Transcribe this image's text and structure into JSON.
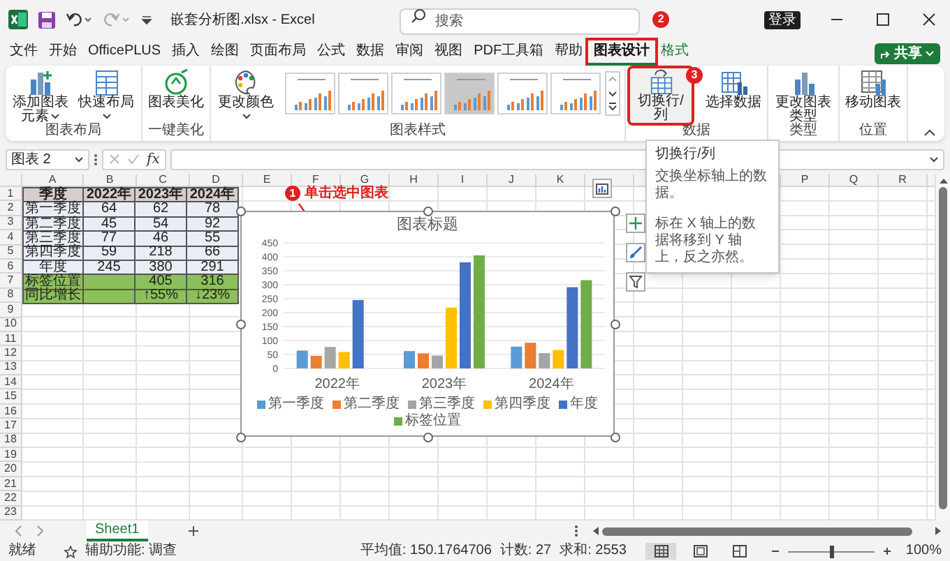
{
  "title_bar": {
    "title": "嵌套分析图.xlsx - Excel",
    "search_placeholder": "搜索",
    "login_button": "登录"
  },
  "menu_tabs": [
    {
      "label": "文件",
      "selected": false,
      "kind": "normal"
    },
    {
      "label": "开始",
      "selected": false,
      "kind": "normal"
    },
    {
      "label": "OfficePLUS",
      "selected": false,
      "kind": "normal"
    },
    {
      "label": "插入",
      "selected": false,
      "kind": "normal"
    },
    {
      "label": "绘图",
      "selected": false,
      "kind": "normal"
    },
    {
      "label": "页面布局",
      "selected": false,
      "kind": "normal"
    },
    {
      "label": "公式",
      "selected": false,
      "kind": "normal"
    },
    {
      "label": "数据",
      "selected": false,
      "kind": "normal"
    },
    {
      "label": "审阅",
      "selected": false,
      "kind": "normal"
    },
    {
      "label": "视图",
      "selected": false,
      "kind": "normal"
    },
    {
      "label": "PDF工具箱",
      "selected": false,
      "kind": "normal"
    },
    {
      "label": "帮助",
      "selected": false,
      "kind": "normal"
    },
    {
      "label": "图表设计",
      "selected": true,
      "kind": "contextual",
      "callout": "2"
    },
    {
      "label": "格式",
      "selected": false,
      "kind": "contextual"
    }
  ],
  "share_button": "共享",
  "ribbon": {
    "groups": [
      {
        "label": "图表布局",
        "commands": [
          {
            "kind": "add-element",
            "label": "添加图表元素",
            "dropdown": true
          },
          {
            "kind": "quick-layout",
            "label": "快速布局",
            "dropdown": true
          }
        ]
      },
      {
        "label": "一键美化",
        "commands": [
          {
            "kind": "beautify",
            "label": "图表美化",
            "dropdown": false
          }
        ]
      },
      {
        "label": "图表样式",
        "commands": [
          {
            "kind": "colors",
            "label": "更改颜色",
            "dropdown": true
          }
        ],
        "gallery": [
          {
            "kind": "plain"
          },
          {
            "kind": "plain"
          },
          {
            "kind": "plain"
          },
          {
            "kind": "shaded"
          },
          {
            "kind": "plain"
          },
          {
            "kind": "plain"
          }
        ]
      },
      {
        "label": "数据",
        "commands": [
          {
            "kind": "switch",
            "label": "切换行/列",
            "dropdown": false,
            "callout": "3"
          },
          {
            "kind": "select-data",
            "label": "选择数据",
            "dropdown": false
          }
        ]
      },
      {
        "label": "类型",
        "commands": [
          {
            "kind": "change-type",
            "label": "更改图表类型",
            "dropdown": false
          }
        ]
      },
      {
        "label": "位置",
        "commands": [
          {
            "kind": "move",
            "label": "移动图表",
            "dropdown": false
          }
        ]
      }
    ]
  },
  "tooltip": {
    "title": "切换行/列",
    "lines": [
      "交换坐标轴上的数据。",
      "标在 X 轴上的数据将移到 Y 轴上，反之亦然。"
    ]
  },
  "formula_bar": {
    "name_box": "图表 2",
    "function_label": "fx"
  },
  "sheet": {
    "columns": [
      "A",
      "B",
      "C",
      "D",
      "E",
      "F",
      "G",
      "H",
      "I",
      "J",
      "K",
      null,
      null,
      null,
      null,
      "P",
      "Q",
      "R"
    ],
    "rows": [
      {
        "number": "1",
        "cells": [
          {
            "text": "季度",
            "kind": "header"
          },
          {
            "text": "2022年",
            "kind": "header"
          },
          {
            "text": "2023年",
            "kind": "header"
          },
          {
            "text": "2024年",
            "kind": "header"
          }
        ]
      },
      {
        "number": "2",
        "cells": [
          {
            "text": "第一季度",
            "kind": "label"
          },
          {
            "text": "64",
            "kind": "data"
          },
          {
            "text": "62",
            "kind": "data"
          },
          {
            "text": "78",
            "kind": "data"
          }
        ]
      },
      {
        "number": "3",
        "cells": [
          {
            "text": "第二季度",
            "kind": "label"
          },
          {
            "text": "45",
            "kind": "data"
          },
          {
            "text": "54",
            "kind": "data"
          },
          {
            "text": "92",
            "kind": "data"
          }
        ]
      },
      {
        "number": "4",
        "cells": [
          {
            "text": "第三季度",
            "kind": "label"
          },
          {
            "text": "77",
            "kind": "data"
          },
          {
            "text": "46",
            "kind": "data"
          },
          {
            "text": "55",
            "kind": "data"
          }
        ]
      },
      {
        "number": "5",
        "cells": [
          {
            "text": "第四季度",
            "kind": "label"
          },
          {
            "text": "59",
            "kind": "data"
          },
          {
            "text": "218",
            "kind": "data"
          },
          {
            "text": "66",
            "kind": "data"
          }
        ]
      },
      {
        "number": "6",
        "cells": [
          {
            "text": "年度",
            "kind": "label"
          },
          {
            "text": "245",
            "kind": "data"
          },
          {
            "text": "380",
            "kind": "data"
          },
          {
            "text": "291",
            "kind": "data"
          }
        ]
      },
      {
        "number": "7",
        "cells": [
          {
            "text": "标签位置",
            "kind": "green"
          },
          {
            "kind": "green"
          },
          {
            "text": "405",
            "kind": "green"
          },
          {
            "text": "316",
            "kind": "green"
          }
        ]
      },
      {
        "number": "8",
        "cells": [
          {
            "text": "同比增长",
            "kind": "green"
          },
          {
            "kind": "green"
          },
          {
            "text": "↑55%",
            "kind": "green"
          },
          {
            "text": "↓23%",
            "kind": "green"
          }
        ]
      },
      {
        "number": "9"
      },
      {
        "number": "10"
      },
      {
        "number": "11"
      },
      {
        "number": "12"
      },
      {
        "number": "13"
      },
      {
        "number": "14"
      },
      {
        "number": "15"
      },
      {
        "number": "16"
      },
      {
        "number": "17"
      },
      {
        "number": "18"
      },
      {
        "number": "19"
      },
      {
        "number": "20"
      },
      {
        "number": "21"
      },
      {
        "number": "22"
      },
      {
        "number": "23"
      }
    ]
  },
  "sheet_callout": {
    "number": "1",
    "text": "单击选中图表"
  },
  "chart": {
    "chart_data": {
      "type": "bar",
      "title": "图表标题",
      "categories": [
        "2022年",
        "2023年",
        "2024年"
      ],
      "series": [
        {
          "name": "第一季度",
          "color": "#5b9bd5",
          "values": [
            64,
            62,
            78
          ]
        },
        {
          "name": "第二季度",
          "color": "#ed7d31",
          "values": [
            45,
            54,
            92
          ]
        },
        {
          "name": "第三季度",
          "color": "#a5a5a5",
          "values": [
            77,
            46,
            55
          ]
        },
        {
          "name": "第四季度",
          "color": "#ffc000",
          "values": [
            59,
            218,
            66
          ]
        },
        {
          "name": "年度",
          "color": "#4472c4",
          "values": [
            245,
            380,
            291
          ]
        },
        {
          "name": "标签位置",
          "color": "#70ad47",
          "values": [
            null,
            405,
            316
          ]
        }
      ],
      "ylim": [
        0,
        450
      ],
      "yticks": [
        0,
        50,
        100,
        150,
        200,
        250,
        300,
        350,
        400,
        450
      ],
      "grid": true,
      "legend": true
    }
  },
  "sheet_tabs": [
    {
      "label": "Sheet1",
      "selected": true
    }
  ],
  "status_bar": {
    "ready": "就绪",
    "accessibility": "辅助功能: 调查",
    "average": "平均值: 150.1764706",
    "count": "计数: 27",
    "sum": "求和: 2553",
    "views": [
      {
        "kind": "normal",
        "selected": true
      },
      {
        "kind": "page-layout",
        "selected": false
      },
      {
        "kind": "page-break",
        "selected": false
      }
    ],
    "zoom": {
      "level": 0.5,
      "reading": "100%"
    }
  }
}
